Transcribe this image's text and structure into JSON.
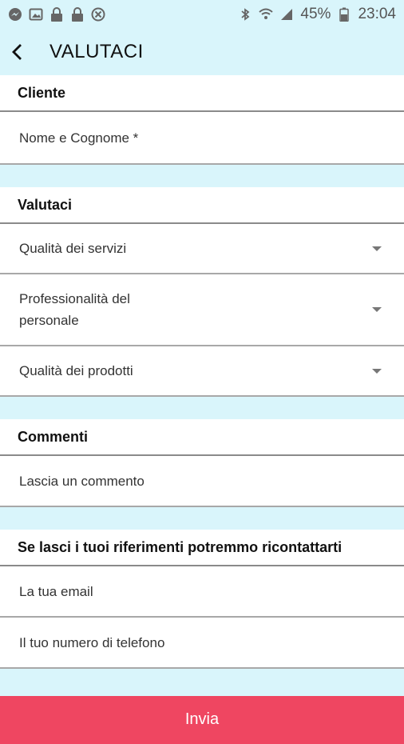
{
  "status": {
    "battery": "45%",
    "time": "23:04"
  },
  "appbar": {
    "title": "VALUTACI"
  },
  "cliente": {
    "header": "Cliente",
    "name_placeholder": "Nome e Cognome *"
  },
  "valutaci": {
    "header": "Valutaci",
    "selects": [
      {
        "label": "Qualità dei servizi"
      },
      {
        "label": "Professionalità del personale"
      },
      {
        "label": "Qualità dei prodotti"
      }
    ]
  },
  "commenti": {
    "header": "Commenti",
    "placeholder": "Lascia un commento"
  },
  "contatti": {
    "header": "Se lasci i tuoi riferimenti potremmo ricontattarti",
    "email_placeholder": "La tua email",
    "phone_placeholder": "Il tuo numero di telefono"
  },
  "submit": {
    "label": "Invia"
  },
  "colors": {
    "background": "#d9f5fb",
    "accent": "#ef4661"
  }
}
